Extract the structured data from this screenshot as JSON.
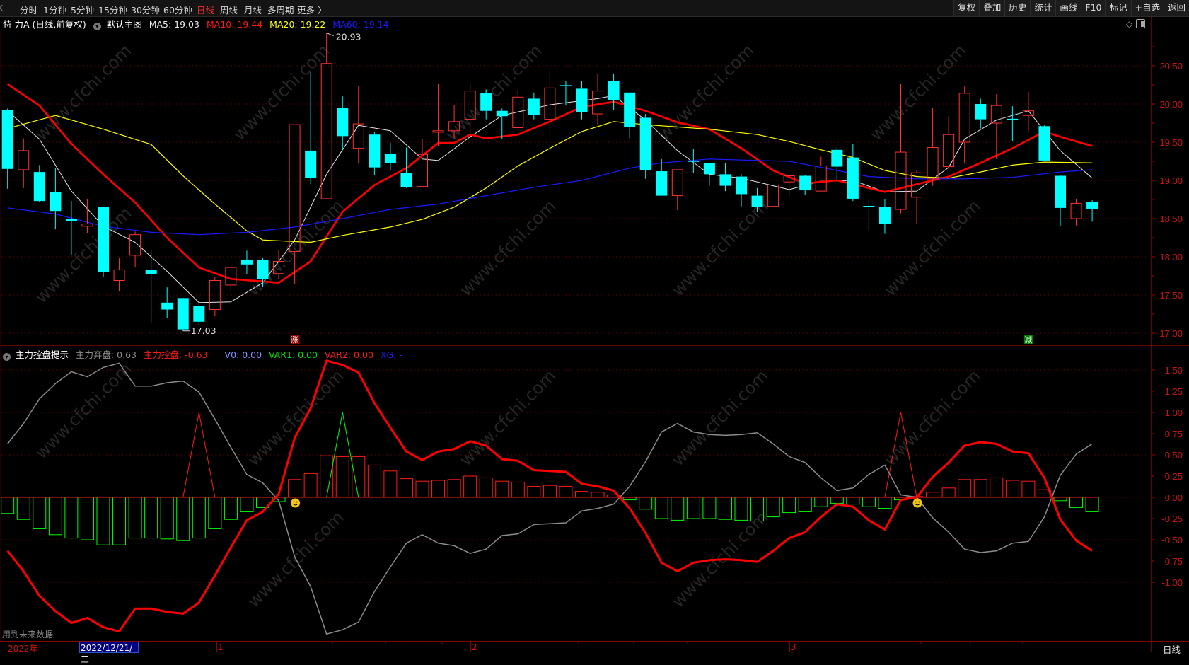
{
  "toolbar": {
    "tabs": [
      "分时",
      "1分钟",
      "5分钟",
      "15分钟",
      "30分钟",
      "60分钟",
      "日线",
      "周线",
      "月线",
      "多周期",
      "更多 〉"
    ],
    "active_tab": "日线",
    "right_buttons": [
      "复权",
      "叠加",
      "历史",
      "统计",
      "画线",
      "F10",
      "标记",
      "+自选",
      "返回"
    ]
  },
  "main_legend": {
    "stock": "特 力A (日线,前复权)",
    "chart_name": "默认主图",
    "ma5": "MA5: 19.03",
    "ma10": "MA10: 19.44",
    "ma20": "MA20: 19.22",
    "ma60": "MA60: 19.14"
  },
  "sub_legend": {
    "name": "主力控盘提示",
    "abandon": "主力弃盘: 0.63",
    "control": "主力控盘: -0.63",
    "v0": "V0: 0.00",
    "var1": "VAR1: 0.00",
    "var2": "VAR2: 0.00",
    "xg": "XG: -"
  },
  "footer_note": "用到未来数据",
  "xaxis": {
    "year": "2022年",
    "cursor_date": "2022/12/21/三",
    "months": [
      "1",
      "2",
      "3"
    ],
    "period": "日线"
  },
  "markers": {
    "rise": "涨",
    "fall": "减",
    "high_label": "20.93",
    "low_label": "17.03"
  },
  "watermark": "www.cfchi.com",
  "colors": {
    "up": "#ff3232",
    "down": "#00ffff",
    "ma5": "#e8e8e8",
    "ma10": "#ff0000",
    "ma20": "#ffff00",
    "ma60": "#1a1aff",
    "grid": "#6a0000",
    "axis": "#d01010",
    "abandon_line": "#8c8c8c",
    "control_line": "#ff0000",
    "neg_bar": "#00ff00"
  },
  "chart_data": [
    {
      "type": "candlestick",
      "title": "特 力A (日线,前复权)",
      "ylim": [
        16.9,
        21.0
      ],
      "yticks": [
        "20.50",
        "20.00",
        "19.50",
        "19.00",
        "18.50",
        "18.00",
        "17.50",
        "17.00"
      ],
      "fields": [
        "open",
        "high",
        "low",
        "close"
      ],
      "candles": [
        [
          19.92,
          19.94,
          18.89,
          19.15
        ],
        [
          19.14,
          19.55,
          18.9,
          19.39
        ],
        [
          19.11,
          19.2,
          18.72,
          18.73
        ],
        [
          18.85,
          19.16,
          18.36,
          18.6
        ],
        [
          18.5,
          18.73,
          18.02,
          18.47
        ],
        [
          18.4,
          18.76,
          18.31,
          18.43
        ],
        [
          18.65,
          18.65,
          17.74,
          17.8
        ],
        [
          17.69,
          17.98,
          17.55,
          17.83
        ],
        [
          18.02,
          18.33,
          17.87,
          18.29
        ],
        [
          17.83,
          18.09,
          17.13,
          17.77
        ],
        [
          17.4,
          17.6,
          17.2,
          17.31
        ],
        [
          17.46,
          17.46,
          17.03,
          17.05
        ],
        [
          17.36,
          17.4,
          17.11,
          17.15
        ],
        [
          17.31,
          17.74,
          17.22,
          17.69
        ],
        [
          17.63,
          17.86,
          17.52,
          17.86
        ],
        [
          17.96,
          18.08,
          17.77,
          17.9
        ],
        [
          17.96,
          17.98,
          17.61,
          17.71
        ],
        [
          17.78,
          18.09,
          17.71,
          17.94
        ],
        [
          18.07,
          19.73,
          17.65,
          19.73
        ],
        [
          19.39,
          20.42,
          18.95,
          19.03
        ],
        [
          18.76,
          20.93,
          18.76,
          20.53
        ],
        [
          19.95,
          20.1,
          19.4,
          19.58
        ],
        [
          19.42,
          20.24,
          19.22,
          19.74
        ],
        [
          19.6,
          19.64,
          19.07,
          19.17
        ],
        [
          19.35,
          19.49,
          19.13,
          19.23
        ],
        [
          19.1,
          19.43,
          18.9,
          18.91
        ],
        [
          18.92,
          19.55,
          18.92,
          19.34
        ],
        [
          19.63,
          20.26,
          19.45,
          19.65
        ],
        [
          19.65,
          19.98,
          19.55,
          19.77
        ],
        [
          19.8,
          20.26,
          19.6,
          20.17
        ],
        [
          20.14,
          20.19,
          19.8,
          19.91
        ],
        [
          19.91,
          19.94,
          19.54,
          19.84
        ],
        [
          19.69,
          20.19,
          19.69,
          20.09
        ],
        [
          20.07,
          20.15,
          19.8,
          19.86
        ],
        [
          19.8,
          20.43,
          19.6,
          20.21
        ],
        [
          20.24,
          20.3,
          19.98,
          20.23
        ],
        [
          20.2,
          20.3,
          19.8,
          19.89
        ],
        [
          19.87,
          20.39,
          19.73,
          20.17
        ],
        [
          20.3,
          20.4,
          19.92,
          20.05
        ],
        [
          20.15,
          20.15,
          19.55,
          19.7
        ],
        [
          19.82,
          19.87,
          19.02,
          19.13
        ],
        [
          19.12,
          19.28,
          18.8,
          18.8
        ],
        [
          18.8,
          19.14,
          18.61,
          19.14
        ],
        [
          19.25,
          19.41,
          19.1,
          19.24
        ],
        [
          19.23,
          19.23,
          18.93,
          19.08
        ],
        [
          19.08,
          19.23,
          18.86,
          18.93
        ],
        [
          19.05,
          19.08,
          18.66,
          18.82
        ],
        [
          18.8,
          18.9,
          18.59,
          18.65
        ],
        [
          18.66,
          18.94,
          18.66,
          18.94
        ],
        [
          18.98,
          19.06,
          18.78,
          19.06
        ],
        [
          19.06,
          19.07,
          18.81,
          18.87
        ],
        [
          18.86,
          19.31,
          18.86,
          19.19
        ],
        [
          19.4,
          19.43,
          18.99,
          19.18
        ],
        [
          19.3,
          19.48,
          18.73,
          18.76
        ],
        [
          18.66,
          18.75,
          18.35,
          18.65
        ],
        [
          18.65,
          18.75,
          18.3,
          18.43
        ],
        [
          18.62,
          20.26,
          18.57,
          19.37
        ],
        [
          18.78,
          19.13,
          18.43,
          19.1
        ],
        [
          19.02,
          19.95,
          18.93,
          19.43
        ],
        [
          19.18,
          19.84,
          19.15,
          19.6
        ],
        [
          19.5,
          20.23,
          19.22,
          20.14
        ],
        [
          20.0,
          20.07,
          19.68,
          19.8
        ],
        [
          19.75,
          20.13,
          19.28,
          19.98
        ],
        [
          19.8,
          19.97,
          19.51,
          19.79
        ],
        [
          19.85,
          20.16,
          19.65,
          19.91
        ],
        [
          19.71,
          19.72,
          19.25,
          19.26
        ],
        [
          19.06,
          19.07,
          18.4,
          18.64
        ],
        [
          18.5,
          18.76,
          18.41,
          18.7
        ],
        [
          18.72,
          18.74,
          18.46,
          18.63
        ]
      ],
      "series": [
        {
          "name": "MA5",
          "key": "ma5",
          "width": 1,
          "points": [
            [
              1,
              19.91
            ],
            [
              3,
              19.54
            ],
            [
              5,
              18.86
            ],
            [
              7,
              18.4
            ],
            [
              9,
              18.19
            ],
            [
              11,
              17.81
            ],
            [
              13,
              17.4
            ],
            [
              15,
              17.41
            ],
            [
              17,
              17.66
            ],
            [
              19,
              18.22
            ],
            [
              21,
              19.08
            ],
            [
              23,
              19.72
            ],
            [
              25,
              19.65
            ],
            [
              27,
              19.28
            ],
            [
              28,
              19.26
            ],
            [
              30,
              19.57
            ],
            [
              32,
              19.85
            ],
            [
              35,
              19.99
            ],
            [
              38,
              20.07
            ],
            [
              39,
              20.11
            ],
            [
              41,
              19.79
            ],
            [
              43,
              19.39
            ],
            [
              45,
              19.08
            ],
            [
              47,
              19.03
            ],
            [
              50,
              18.88
            ],
            [
              52,
              18.99
            ],
            [
              54,
              19.0
            ],
            [
              56,
              18.85
            ],
            [
              58,
              18.86
            ],
            [
              60,
              19.17
            ],
            [
              61,
              19.54
            ],
            [
              63,
              19.79
            ],
            [
              65,
              19.91
            ],
            [
              67,
              19.39
            ],
            [
              69,
              19.03
            ]
          ]
        },
        {
          "name": "MA10",
          "key": "ma10",
          "width": 2.6,
          "points": [
            [
              1,
              20.26
            ],
            [
              3,
              19.98
            ],
            [
              5,
              19.48
            ],
            [
              7,
              19.08
            ],
            [
              9,
              18.71
            ],
            [
              11,
              18.25
            ],
            [
              13,
              17.86
            ],
            [
              15,
              17.71
            ],
            [
              18,
              17.66
            ],
            [
              20,
              17.94
            ],
            [
              22,
              18.59
            ],
            [
              24,
              18.94
            ],
            [
              26,
              19.16
            ],
            [
              28,
              19.49
            ],
            [
              29,
              19.49
            ],
            [
              30,
              19.6
            ],
            [
              31,
              19.55
            ],
            [
              33,
              19.6
            ],
            [
              35,
              19.77
            ],
            [
              37,
              19.96
            ],
            [
              39,
              20.03
            ],
            [
              41,
              19.91
            ],
            [
              43,
              19.76
            ],
            [
              45,
              19.67
            ],
            [
              47,
              19.42
            ],
            [
              49,
              19.13
            ],
            [
              51,
              18.96
            ],
            [
              53,
              19.0
            ],
            [
              56,
              18.85
            ],
            [
              58,
              18.95
            ],
            [
              60,
              19.05
            ],
            [
              62,
              19.23
            ],
            [
              64,
              19.42
            ],
            [
              66,
              19.64
            ],
            [
              67,
              19.57
            ],
            [
              69,
              19.45
            ]
          ]
        },
        {
          "name": "MA20",
          "key": "ma20",
          "width": 1.2,
          "points": [
            [
              1,
              19.68
            ],
            [
              4,
              19.85
            ],
            [
              7,
              19.67
            ],
            [
              10,
              19.47
            ],
            [
              12,
              19.06
            ],
            [
              14,
              18.69
            ],
            [
              16,
              18.34
            ],
            [
              17,
              18.22
            ],
            [
              20,
              18.19
            ],
            [
              22,
              18.28
            ],
            [
              25,
              18.39
            ],
            [
              27,
              18.49
            ],
            [
              29,
              18.65
            ],
            [
              31,
              18.9
            ],
            [
              33,
              19.19
            ],
            [
              35,
              19.42
            ],
            [
              37,
              19.64
            ],
            [
              39,
              19.77
            ],
            [
              41,
              19.73
            ],
            [
              45,
              19.67
            ],
            [
              48,
              19.6
            ],
            [
              50,
              19.51
            ],
            [
              52,
              19.4
            ],
            [
              54,
              19.3
            ],
            [
              56,
              19.13
            ],
            [
              58,
              19.05
            ],
            [
              60,
              19.03
            ],
            [
              62,
              19.11
            ],
            [
              64,
              19.2
            ],
            [
              66,
              19.24
            ],
            [
              69,
              19.23
            ]
          ]
        },
        {
          "name": "MA60",
          "key": "ma60",
          "width": 1.2,
          "points": [
            [
              1,
              18.64
            ],
            [
              4,
              18.56
            ],
            [
              7,
              18.4
            ],
            [
              10,
              18.32
            ],
            [
              13,
              18.29
            ],
            [
              16,
              18.32
            ],
            [
              19,
              18.39
            ],
            [
              22,
              18.5
            ],
            [
              25,
              18.62
            ],
            [
              28,
              18.69
            ],
            [
              31,
              18.8
            ],
            [
              34,
              18.91
            ],
            [
              37,
              19.0
            ],
            [
              40,
              19.16
            ],
            [
              42,
              19.23
            ],
            [
              45,
              19.28
            ],
            [
              48,
              19.26
            ],
            [
              50,
              19.25
            ],
            [
              52,
              19.17
            ],
            [
              55,
              19.05
            ],
            [
              58,
              19.02
            ],
            [
              61,
              19.02
            ],
            [
              64,
              19.04
            ],
            [
              67,
              19.11
            ],
            [
              69,
              19.14
            ]
          ]
        }
      ],
      "high_point": {
        "index": 21,
        "value": 20.93
      },
      "low_point": {
        "index": 12,
        "value": 17.03
      },
      "rise_marker_index": 19,
      "fall_marker_index": 65
    },
    {
      "type": "line+bar",
      "title": "主力控盘提示",
      "ylim": [
        -1.7,
        1.8
      ],
      "yticks": [
        "1.50",
        "1.25",
        "1.00",
        "0.75",
        "0.50",
        "0.25",
        "0.00",
        "-0.25",
        "-0.50",
        "-0.75",
        "-1.00"
      ],
      "gridlines": [
        1.5,
        1.0,
        0.5,
        0,
        -0.5,
        -1.0
      ],
      "control": [
        -0.63,
        -0.87,
        -1.16,
        -1.34,
        -1.48,
        -1.42,
        -1.53,
        -1.58,
        -1.31,
        -1.31,
        -1.35,
        -1.37,
        -1.24,
        -0.92,
        -0.59,
        -0.27,
        -0.17,
        0.04,
        0.7,
        1.05,
        1.61,
        1.56,
        1.47,
        1.11,
        0.82,
        0.54,
        0.44,
        0.54,
        0.57,
        0.66,
        0.61,
        0.45,
        0.43,
        0.32,
        0.31,
        0.3,
        0.16,
        0.13,
        0.08,
        -0.13,
        -0.42,
        -0.77,
        -0.87,
        -0.77,
        -0.74,
        -0.73,
        -0.74,
        -0.76,
        -0.63,
        -0.48,
        -0.41,
        -0.23,
        -0.08,
        -0.11,
        -0.27,
        -0.38,
        -0.03,
        0.0,
        0.24,
        0.41,
        0.61,
        0.65,
        0.63,
        0.54,
        0.52,
        0.23,
        -0.26,
        -0.51,
        -0.63
      ],
      "abandon_is_negated_control": true,
      "bars": [
        -0.19,
        -0.26,
        -0.37,
        -0.44,
        -0.48,
        -0.5,
        -0.56,
        -0.56,
        -0.48,
        -0.48,
        -0.49,
        -0.51,
        -0.48,
        -0.37,
        -0.26,
        -0.17,
        -0.12,
        -0.05,
        0.21,
        0.28,
        0.49,
        0.48,
        0.48,
        0.38,
        0.31,
        0.22,
        0.19,
        0.2,
        0.21,
        0.25,
        0.23,
        0.19,
        0.18,
        0.13,
        0.14,
        0.13,
        0.07,
        0.06,
        0.03,
        -0.03,
        -0.14,
        -0.25,
        -0.27,
        -0.25,
        -0.25,
        -0.26,
        -0.27,
        -0.28,
        -0.23,
        -0.18,
        -0.17,
        -0.11,
        -0.07,
        -0.08,
        -0.11,
        -0.13,
        -0.03,
        0.01,
        0.06,
        0.11,
        0.21,
        0.21,
        0.23,
        0.2,
        0.19,
        0.09,
        -0.04,
        -0.12,
        -0.17
      ],
      "red_spikes": [
        13,
        57
      ],
      "green_spikes": [
        22
      ],
      "spike_value": 1.0,
      "smiley_indices": [
        19,
        58
      ]
    }
  ]
}
